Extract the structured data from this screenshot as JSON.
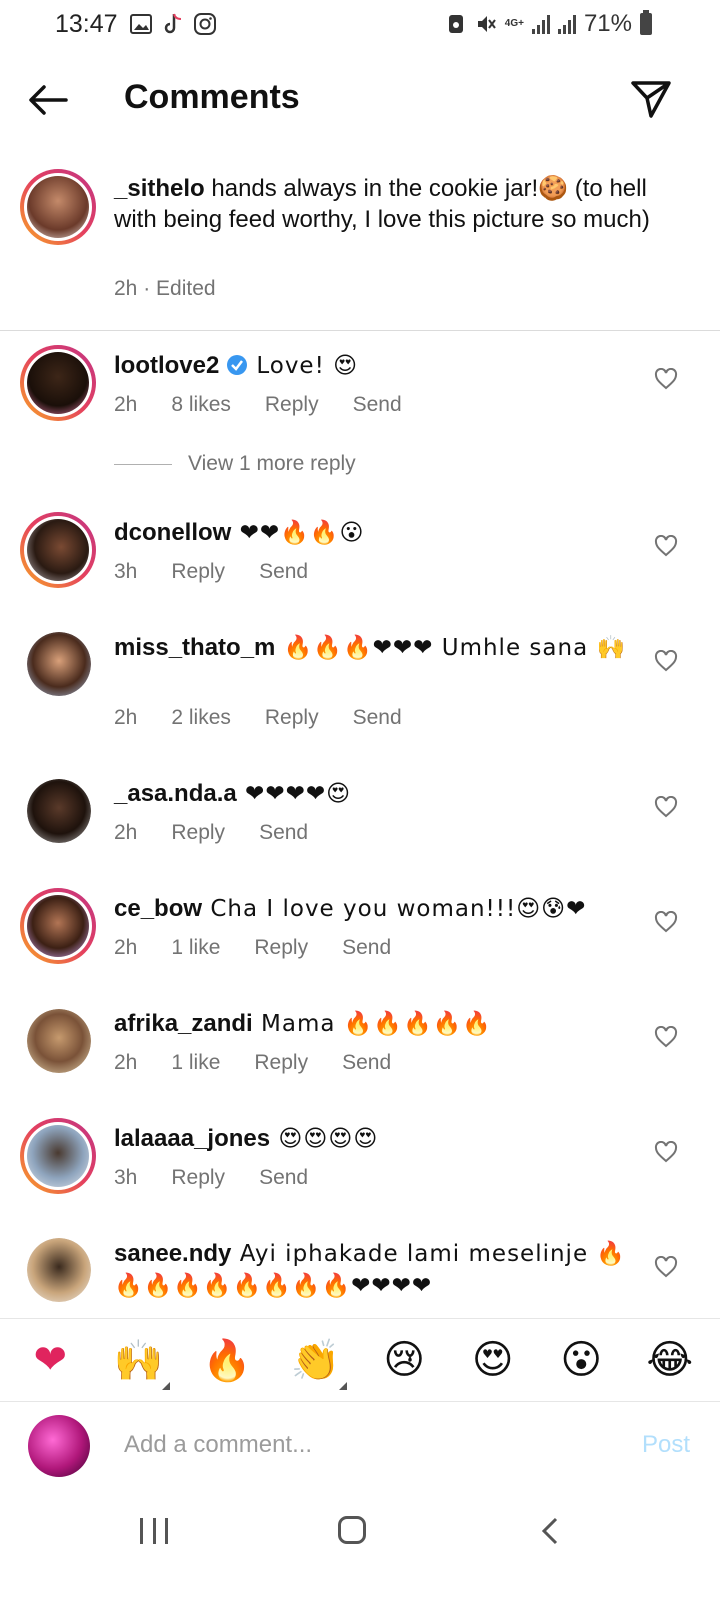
{
  "status_bar": {
    "time": "13:47",
    "network": "4G+",
    "battery": "71%",
    "left_icons": [
      "gallery-icon",
      "tiktok-icon",
      "instagram-icon"
    ],
    "right_icons": [
      "recycle-icon",
      "mute-icon",
      "network-icon",
      "signal-icon",
      "signal-icon",
      "battery-icon"
    ]
  },
  "header": {
    "title": "Comments",
    "back_icon": "arrow-left-icon",
    "send_icon": "paper-plane-icon"
  },
  "caption": {
    "username": "_sithelo",
    "text": " hands always in the cookie jar!🍪 (to hell with being feed worthy, I love this picture so much)",
    "time": "2h · Edited"
  },
  "comments": [
    {
      "username": "lootlove2",
      "verified": true,
      "text": " Love! 😍",
      "time": "2h",
      "likes": "8 likes",
      "reply": "Reply",
      "send": "Send"
    },
    {
      "username": "dconellow",
      "text": " ❤❤🔥🔥😮",
      "time": "3h",
      "likes": "",
      "reply": "Reply",
      "send": "Send"
    },
    {
      "username": "miss_thato_m",
      "text": " 🔥🔥🔥❤❤❤ Umhle sana 🙌",
      "time": "2h",
      "likes": "2 likes",
      "reply": "Reply",
      "send": "Send"
    },
    {
      "username": "_asa.nda.a",
      "text": " ❤❤❤❤😍",
      "time": "2h",
      "likes": "",
      "reply": "Reply",
      "send": "Send"
    },
    {
      "username": "ce_bow",
      "text": " Cha I love you woman!!!😍😰❤",
      "time": "2h",
      "likes": "1 like",
      "reply": "Reply",
      "send": "Send"
    },
    {
      "username": "afrika_zandi",
      "text": " Mama 🔥🔥🔥🔥🔥",
      "time": "2h",
      "likes": "1 like",
      "reply": "Reply",
      "send": "Send"
    },
    {
      "username": "lalaaaa_jones",
      "text": " 😍😍😍😍",
      "time": "3h",
      "likes": "",
      "reply": "Reply",
      "send": "Send"
    },
    {
      "username": "sanee.ndy",
      "text": " Ayi iphakade lami meselinje 🔥🔥🔥🔥🔥🔥🔥🔥🔥❤❤❤❤",
      "time": "",
      "likes": "",
      "reply": "",
      "send": ""
    }
  ],
  "view_more": "View 1 more reply",
  "reactions": [
    "❤",
    "🙌",
    "🔥",
    "👏",
    "😢",
    "😍",
    "😮",
    "😂"
  ],
  "composer": {
    "placeholder": "Add a comment...",
    "post": "Post"
  },
  "colors": {
    "meta_text": "#737373",
    "post_disabled": "#b2dffc",
    "verified": "#3897f0",
    "divider": "#dbdbdb"
  }
}
